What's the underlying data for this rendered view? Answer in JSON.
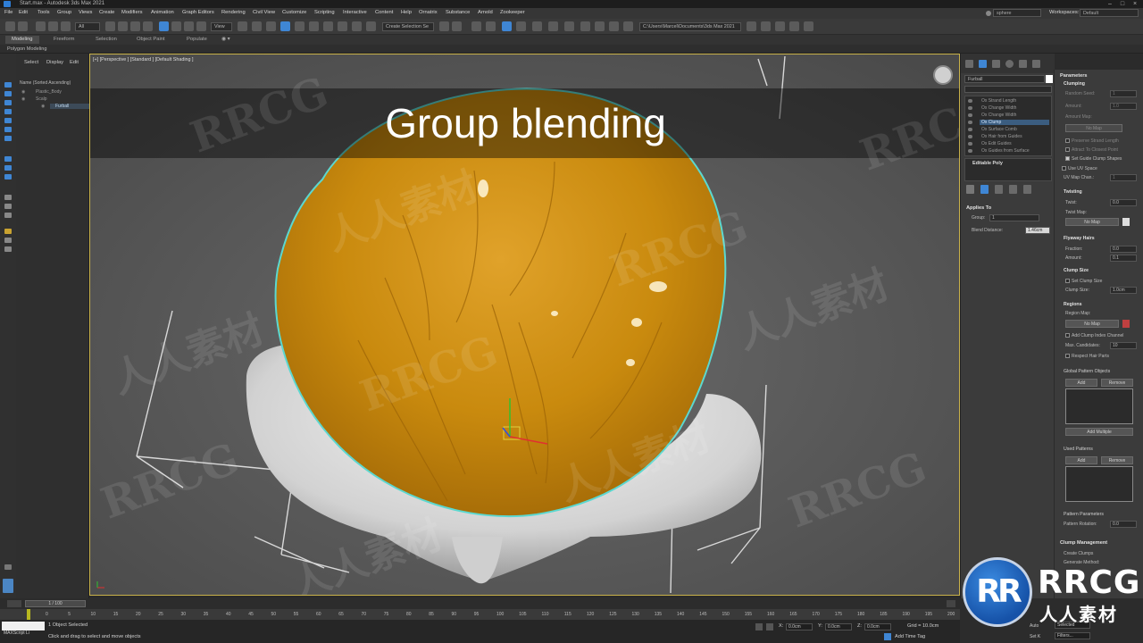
{
  "window": {
    "title": "Start.max - Autodesk 3ds Max 2021"
  },
  "menu": {
    "items": [
      "File",
      "Edit",
      "Tools",
      "Group",
      "Views",
      "Create",
      "Modifiers",
      "Animation",
      "Graph Editors",
      "Rendering",
      "Civil View",
      "Customize",
      "Scripting",
      "Interactive",
      "Content",
      "Help",
      "Ornatrix",
      "Substance",
      "Arnold",
      "Zookeeper"
    ],
    "user": "sphere",
    "workspace_label": "Workspaces:",
    "workspace_value": "Default"
  },
  "toolbar": {
    "view_dropdown": "View",
    "selection_set": "Create Selection Se",
    "project_path": "C:\\Users\\Marcel\\Documents\\3ds Max 2021"
  },
  "ribbon": {
    "tabs": [
      "Modeling",
      "Freeform",
      "Selection",
      "Object Paint",
      "Populate"
    ],
    "sub_label": "Polygon Modeling"
  },
  "explorer": {
    "tabs": [
      "Select",
      "Display",
      "Edit"
    ],
    "sort_label": "Name (Sorted Ascending)",
    "items": [
      "Plastic_Body",
      "Scalp",
      "Furball"
    ]
  },
  "viewport": {
    "label": "[+] [Perspective ] [Standard ] [Default Shading ]",
    "overlay_title_light": "Group ",
    "overlay_title_bold": "blending",
    "watermark_text": "RRCG",
    "watermark_text_cn": "人人素材"
  },
  "command_panel": {
    "object_name": "Furball",
    "color_swatch": "#ffffff",
    "modifiers": [
      "Ox Strand Length",
      "Ox Change Width",
      "Ox Change Width",
      "Ox Clump",
      "Ox Surface Comb",
      "Ox Hair from Guides",
      "Ox Edit Guides",
      "Ox Guides from Surface"
    ],
    "selected_modifier_index": 3,
    "base_object": "Editable Poly",
    "applies_to": {
      "header": "Applies To",
      "group_label": "Group:",
      "group_value": "1",
      "blend_label": "Blend Distance:",
      "blend_value": "1.46cm"
    }
  },
  "parameters": {
    "header": "Parameters",
    "clumping": {
      "header": "Clumping",
      "random_seed_label": "Random Seed:",
      "random_seed_value": "1",
      "amount_label": "Amount:",
      "amount_value": "1.0",
      "amount_map_label": "Amount Map:",
      "no_map": "No Map",
      "preserve_strand_length": "Preserve Strand Length",
      "attract_to_closest_point": "Attract To Closest Point",
      "set_guide_clump_shapes": "Set Guide Clump Shapes",
      "use_uv_space": "Use UV Space",
      "uv_map_channel_label": "UV Map Chan.:",
      "uv_map_channel_value": "1"
    },
    "twisting": {
      "header": "Twisting",
      "twist_label": "Twist:",
      "twist_value": "0.0",
      "twist_map_label": "Twist Map:",
      "no_map": "No Map"
    },
    "flyaway": {
      "header": "Flyaway Hairs",
      "fraction_label": "Fraction:",
      "fraction_value": "0.0",
      "amount_label": "Amount:",
      "amount_value": "0.1"
    },
    "clump_size": {
      "header": "Clump Size",
      "set_clump_size": "Set Clump Size",
      "clump_size_label": "Clump Size:",
      "clump_size_value": "1.0cm"
    },
    "regions": {
      "header": "Regions",
      "region_map_label": "Region Map:",
      "no_map": "No Map",
      "add_clump_index_channel": "Add Clump Index Channel",
      "max_candidates_label": "Max. Candidates:",
      "max_candidates_value": "10",
      "respect_hair_parts": "Respect Hair Parts"
    },
    "global_pattern": {
      "header": "Global Pattern Objects",
      "add": "Add",
      "remove": "Remove",
      "add_multiple": "Add Multiple"
    },
    "used_patterns": {
      "header": "Used Patterns",
      "add": "Add",
      "remove": "Remove"
    },
    "pattern_parameters": {
      "header": "Pattern Parameters",
      "rotation_label": "Pattern Rotation:",
      "rotation_value": "0.0"
    },
    "clump_management": {
      "header": "Clump Management",
      "create_clumps": "Create Clumps",
      "generate_method": "Generate Method:"
    }
  },
  "timeline": {
    "frame_display": "1 / 100",
    "ticks": [
      "0",
      "5",
      "10",
      "15",
      "20",
      "25",
      "30",
      "35",
      "40",
      "45",
      "50",
      "55",
      "60",
      "65",
      "70",
      "75",
      "80",
      "85",
      "90",
      "95",
      "100",
      "105",
      "110",
      "115",
      "120",
      "125",
      "130",
      "135",
      "140",
      "145",
      "150",
      "155",
      "160",
      "165",
      "170",
      "175",
      "180",
      "185",
      "190",
      "195",
      "200"
    ]
  },
  "status": {
    "selection": "1 Object Selected",
    "prompt": "Click and drag to select and move objects",
    "script_label": "MAXScript Li",
    "x_label": "X:",
    "x_value": "0.0cm",
    "y_label": "Y:",
    "y_value": "0.0cm",
    "z_label": "Z:",
    "z_value": "0.0cm",
    "grid_label": "Grid = 10.0cm",
    "add_time_tag": "Add Time Tag",
    "auto_label": "Auto",
    "set_key_label": "Set K",
    "selected_dropdown": "Selected",
    "filters_label": "Filters..."
  },
  "badge": {
    "logo_mono": "RR",
    "brand": "RRCG",
    "brand_cn": "人人素材"
  },
  "colors": {
    "accent_blue": "#3f86d4",
    "hair_orange": "#d4920e",
    "viewport_bg": "#585858",
    "viewport_border": "#c9b24a"
  }
}
